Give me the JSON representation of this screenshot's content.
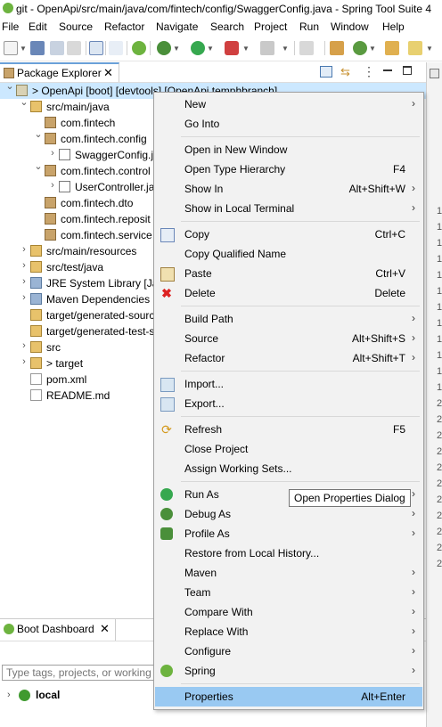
{
  "window": {
    "title": "git - OpenApi/src/main/java/com/fintech/config/SwaggerConfig.java - Spring Tool Suite 4"
  },
  "menubar": [
    "File",
    "Edit",
    "Source",
    "Refactor",
    "Navigate",
    "Search",
    "Project",
    "Run",
    "Window",
    "Help"
  ],
  "package_explorer": {
    "tab_label": "Package Explorer",
    "tree": [
      {
        "label": "> OpenApi [boot] [devtools] [OpenApi temphbranch]",
        "indent": 0,
        "arrow": "⌄",
        "icon": "project-icon",
        "selected": true
      },
      {
        "label": "src/main/java",
        "indent": 1,
        "arrow": "⌄",
        "icon": "source-folder-icon"
      },
      {
        "label": "com.fintech",
        "indent": 2,
        "arrow": "",
        "icon": "package-icon"
      },
      {
        "label": "com.fintech.config",
        "indent": 2,
        "arrow": "⌄",
        "icon": "package-icon"
      },
      {
        "label": "SwaggerConfig.j",
        "indent": 3,
        "arrow": "›",
        "icon": "java-file-icon"
      },
      {
        "label": "com.fintech.control",
        "indent": 2,
        "arrow": "⌄",
        "icon": "package-icon"
      },
      {
        "label": "UserController.ja",
        "indent": 3,
        "arrow": "›",
        "icon": "java-file-icon"
      },
      {
        "label": "com.fintech.dto",
        "indent": 2,
        "arrow": "",
        "icon": "package-icon"
      },
      {
        "label": "com.fintech.reposit",
        "indent": 2,
        "arrow": "",
        "icon": "package-icon"
      },
      {
        "label": "com.fintech.service",
        "indent": 2,
        "arrow": "",
        "icon": "package-icon"
      },
      {
        "label": "src/main/resources",
        "indent": 1,
        "arrow": "›",
        "icon": "source-folder-icon"
      },
      {
        "label": "src/test/java",
        "indent": 1,
        "arrow": "›",
        "icon": "source-folder-icon"
      },
      {
        "label": "JRE System Library [Jav",
        "indent": 1,
        "arrow": "›",
        "icon": "library-icon"
      },
      {
        "label": "Maven Dependencies",
        "indent": 1,
        "arrow": "›",
        "icon": "library-icon"
      },
      {
        "label": "target/generated-sourc",
        "indent": 1,
        "arrow": "",
        "icon": "source-folder-icon"
      },
      {
        "label": "target/generated-test-s",
        "indent": 1,
        "arrow": "",
        "icon": "source-folder-icon"
      },
      {
        "label": "src",
        "indent": 1,
        "arrow": "›",
        "icon": "folder-icon"
      },
      {
        "label": "> target",
        "indent": 1,
        "arrow": "›",
        "icon": "folder-icon"
      },
      {
        "label": "pom.xml",
        "indent": 1,
        "arrow": "",
        "icon": "xml-file-icon"
      },
      {
        "label": "README.md",
        "indent": 1,
        "arrow": "",
        "icon": "file-icon"
      }
    ]
  },
  "boot_dashboard": {
    "tab_label": "Boot Dashboard",
    "filter_placeholder": "Type tags, projects, or working s",
    "items": [
      {
        "label": "local"
      }
    ]
  },
  "context_menu": {
    "items": [
      {
        "label": "New",
        "submenu": true
      },
      {
        "label": "Go Into"
      },
      {
        "sep": true
      },
      {
        "label": "Open in New Window"
      },
      {
        "label": "Open Type Hierarchy",
        "shortcut": "F4"
      },
      {
        "label": "Show In",
        "shortcut": "Alt+Shift+W",
        "submenu": true
      },
      {
        "label": "Show in Local Terminal",
        "submenu": true
      },
      {
        "sep": true
      },
      {
        "label": "Copy",
        "shortcut": "Ctrl+C",
        "icon": "copy-icon"
      },
      {
        "label": "Copy Qualified Name"
      },
      {
        "label": "Paste",
        "shortcut": "Ctrl+V",
        "icon": "paste-icon"
      },
      {
        "label": "Delete",
        "shortcut": "Delete",
        "icon": "delete-icon"
      },
      {
        "sep": true
      },
      {
        "label": "Build Path",
        "submenu": true
      },
      {
        "label": "Source",
        "shortcut": "Alt+Shift+S",
        "submenu": true
      },
      {
        "label": "Refactor",
        "shortcut": "Alt+Shift+T",
        "submenu": true
      },
      {
        "sep": true
      },
      {
        "label": "Import...",
        "icon": "import-icon"
      },
      {
        "label": "Export...",
        "icon": "export-icon"
      },
      {
        "sep": true
      },
      {
        "label": "Refresh",
        "shortcut": "F5",
        "icon": "refresh-icon"
      },
      {
        "label": "Close Project"
      },
      {
        "label": "Assign Working Sets..."
      },
      {
        "sep": true
      },
      {
        "label": "Run As",
        "submenu": true,
        "icon": "run-icon"
      },
      {
        "label": "Debug As",
        "submenu": true,
        "icon": "debug-icon"
      },
      {
        "label": "Profile As",
        "submenu": true,
        "icon": "profile-icon"
      },
      {
        "label": "Restore from Local History..."
      },
      {
        "label": "Maven",
        "submenu": true
      },
      {
        "label": "Team",
        "submenu": true
      },
      {
        "label": "Compare With",
        "submenu": true
      },
      {
        "label": "Replace With",
        "submenu": true
      },
      {
        "label": "Configure",
        "submenu": true
      },
      {
        "label": "Spring",
        "submenu": true,
        "icon": "spring-icon"
      },
      {
        "sep": true
      },
      {
        "label": "Properties",
        "shortcut": "Alt+Enter",
        "highlighted": true
      }
    ]
  },
  "tooltip": "Open Properties Dialog",
  "editor_line_numbers": [
    "1",
    "1",
    "1",
    "1",
    "1",
    "1",
    "1",
    "1",
    "1",
    "1",
    "1",
    "1",
    "2",
    "2",
    "2",
    "2",
    "2",
    "2",
    "2",
    "2",
    "2",
    "2",
    "2"
  ],
  "colors": {
    "selection": "#cce8ff",
    "menu_highlight": "#99c9f2",
    "spring_green": "#6db33f"
  }
}
